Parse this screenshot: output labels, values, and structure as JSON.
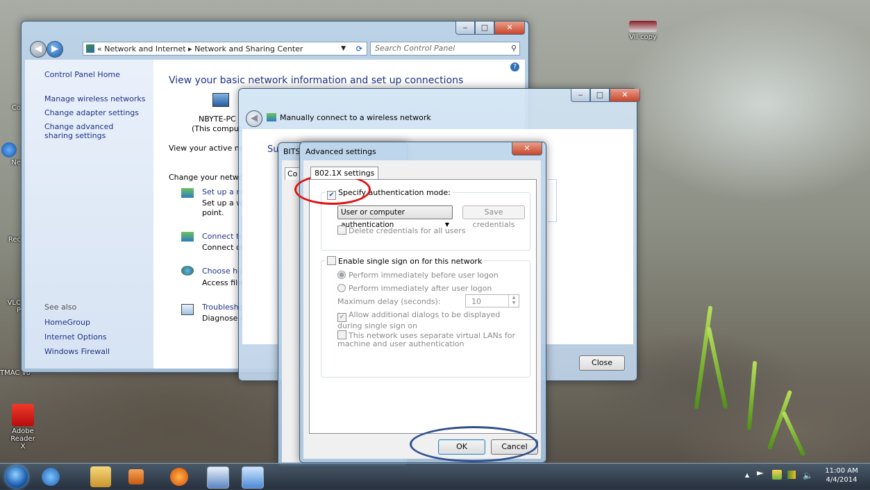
{
  "desktop": {
    "icons": [
      {
        "label": "VII copy"
      },
      {
        "label": "Co"
      },
      {
        "label": "Ne"
      },
      {
        "label": "Rec"
      },
      {
        "label": "VLC\nP"
      },
      {
        "label": "TMAC v6"
      },
      {
        "label": "Adobe Reader X"
      }
    ]
  },
  "explorer": {
    "breadcrumb_prefix": "«",
    "breadcrumb_1": "Network and Internet",
    "breadcrumb_sep": "▸",
    "breadcrumb_2": "Network and Sharing Center",
    "search_placeholder": "Search Control Panel",
    "sidebar": {
      "home": "Control Panel Home",
      "links": [
        "Manage wireless networks",
        "Change adapter settings",
        "Change advanced sharing settings"
      ],
      "see_also_label": "See also",
      "see_also": [
        "HomeGroup",
        "Internet Options",
        "Windows Firewall"
      ]
    },
    "heading": "View your basic network information and set up connections",
    "computer_name": "NBYTE-PC",
    "computer_sub": "(This comput",
    "active_networks": "View your active netw",
    "change_settings": "Change your network",
    "tasks": [
      {
        "title": "Set up a ne",
        "desc": "Set up a wi",
        "desc2": "point."
      },
      {
        "title": "Connect to",
        "desc": "Connect or"
      },
      {
        "title": "Choose ho",
        "desc": "Access file"
      },
      {
        "title": "Troublesho",
        "desc": "Diagnose a"
      }
    ]
  },
  "wizard": {
    "title": "Manually connect to a wireless network",
    "partial_text": "Su",
    "close_label": "Close"
  },
  "props": {
    "title_partial": "BITS",
    "tab_partial": "Co"
  },
  "advanced": {
    "title": "Advanced settings",
    "tab": "802.1X settings",
    "specify_auth": "Specify authentication mode:",
    "auth_mode": "User or computer authentication",
    "save_credentials": "Save credentials",
    "delete_credentials": "Delete credentials for all users",
    "enable_sso": "Enable single sign on for this network",
    "perform_before": "Perform immediately before user logon",
    "perform_after": "Perform immediately after user logon",
    "max_delay_label": "Maximum delay (seconds):",
    "max_delay_value": "10",
    "allow_dialogs": "Allow additional dialogs to be displayed during single sign on",
    "separate_vlans": "This network uses separate virtual LANs for machine and user authentication",
    "ok": "OK",
    "cancel": "Cancel"
  },
  "taskbar": {
    "time": "11:00 AM",
    "date": "4/4/2014",
    "tray_arrow": "▲"
  },
  "annotations": {
    "red_circle_color": "#e01010",
    "blue_circle_color": "#2f4f8f"
  }
}
